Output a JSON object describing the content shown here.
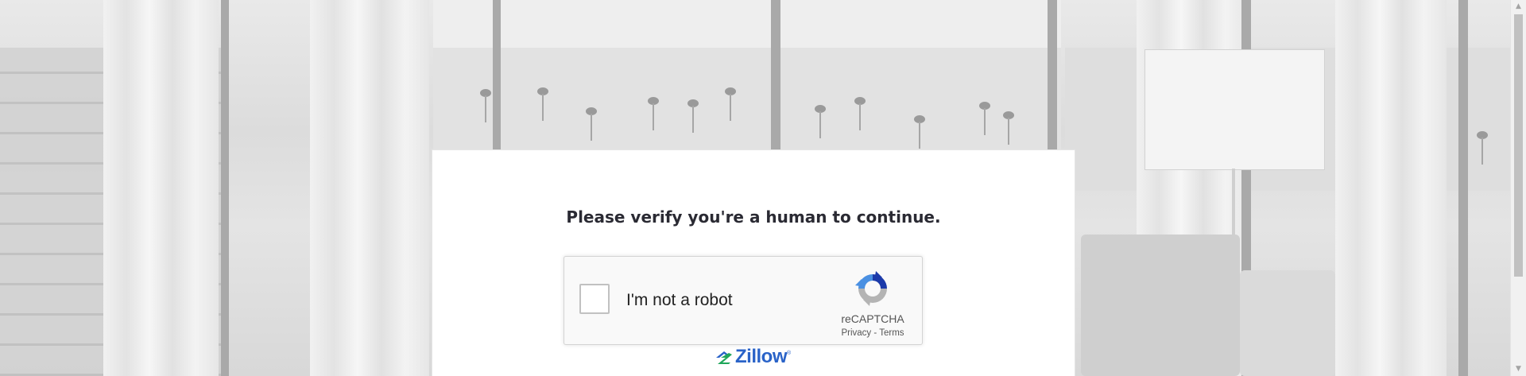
{
  "page": {
    "heading": "Please verify you're a human to continue."
  },
  "recaptcha": {
    "checkbox_label": "I'm not a robot",
    "brand": "reCAPTCHA",
    "privacy_link": "Privacy",
    "separator": "-",
    "terms_link": "Terms",
    "logo_icon": "recaptcha-logo-icon"
  },
  "footer": {
    "logo_text": "Zillow",
    "trademark": "®",
    "logo_icon": "zillow-house-icon"
  },
  "colors": {
    "heading_text": "#2a2a33",
    "zillow_blue": "#2a63c8",
    "recaptcha_blue": "#1c3aa9",
    "recaptcha_light_blue": "#4a90e2",
    "recaptcha_gray": "#b4b4b4"
  },
  "scrollbar": {
    "up_arrow": "▲",
    "down_arrow": "▼"
  }
}
